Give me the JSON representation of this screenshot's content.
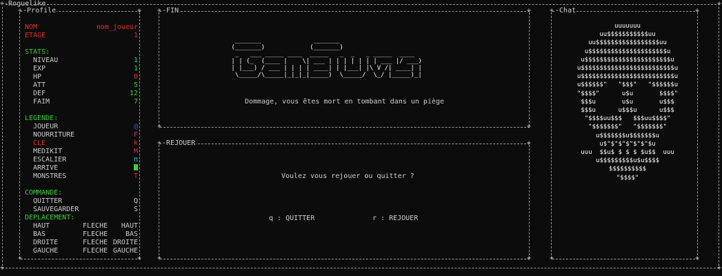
{
  "window": {
    "title": "Roguelike"
  },
  "panels": {
    "profile": "Profile",
    "fin": "FIN",
    "rejouer": "REJOUER",
    "chat": "Chat"
  },
  "profile": {
    "name_label": "NOM",
    "name_value": "nom_joueur",
    "floor_label": "ETAGE",
    "floor_value": "1",
    "stats_header": "STATS:",
    "stats": [
      {
        "label": "NIVEAU",
        "value": "1"
      },
      {
        "label": "EXP",
        "value": "1"
      },
      {
        "label": "HP",
        "value": "0"
      },
      {
        "label": "ATT",
        "value": "5"
      },
      {
        "label": "DEF",
        "value": "12"
      },
      {
        "label": "FAIM",
        "value": "7"
      }
    ],
    "legend_header": "LEGENDE:",
    "legend": [
      {
        "label": "JOUEUR",
        "symbol": "@"
      },
      {
        "label": "NOURRITURE",
        "symbol": "F"
      },
      {
        "label": "CLE",
        "symbol": "k"
      },
      {
        "label": "MEDIKIT",
        "symbol": "M"
      },
      {
        "label": "ESCALIER",
        "symbol": "π"
      },
      {
        "label": "ARRIVE",
        "symbol": ""
      },
      {
        "label": "MONSTRES",
        "symbol": "T"
      }
    ],
    "commands_header": "COMMANDE:",
    "commands": [
      {
        "label": "QUITTER",
        "key": "Q"
      },
      {
        "label": "SAUVEGARDER",
        "key": "S"
      }
    ],
    "moves_header": "DEPLACEMENT:",
    "moves": [
      {
        "label": "HAUT",
        "key": "FLECHE",
        "dir": "HAUT"
      },
      {
        "label": "BAS",
        "key": "FLECHE",
        "dir": "BAS"
      },
      {
        "label": "DROITE",
        "key": "FLECHE",
        "dir": "DROITE"
      },
      {
        "label": "GAUCHE",
        "key": "FLECHE",
        "dir": "GAUCHE"
      }
    ]
  },
  "fin": {
    "ascii_art": "  _______              _______\n (_______)            (_______)\n  _   ___ _____ ____  _____   _  _   _ _____  ____\n | | (_  (____ |    \\| ___ | | | | | | | ___ |/ ___)\n | |___) / ___ | | | | ____| | |___| |\\ V /| ____| |\n  \\_____/\\_____|_|_|_|_____)  \\_____/  \\_/ |_____)_|",
    "message": "Dommage, vous êtes mort en tombant dans un piège"
  },
  "rejouer": {
    "question": "Voulez vous rejouer ou quitter ?",
    "quit_option": "q : QUITTER",
    "replay_option": "r : REJOUER"
  },
  "chat": {
    "skull_art": "uuuuuuu\nuu$$$$$$$$$$$uu\nuu$$$$$$$$$$$$$$$$$uu\nu$$$$$$$$$$$$$$$$$$$$$u\nu$$$$$$$$$$$$$$$$$$$$$$$u\nu$$$$$$$$$$$$$$$$$$$$$$$$$u\nu$$$$$$$$$$$$$$$$$$$$$$$$$u\nu$$$$$$\"   \"$$$\"   \"$$$$$$u\n\"$$$$\"      u$u       $$$$\"\n$$$u       u$u       u$$$\n$$$u      u$$$u      u$$$\n\"$$$$uu$$$   $$$uu$$$$\"\n\"$$$$$$$\"   \"$$$$$$$\"\nu$$$$$$$u$$$$$$$u\nu$\"$\"$\"$\"$\"$\"$u\nuuu  $$u$ $ $ $ $u$$  uuu\nu$$$$$$$$$u$u$$$$\n$$$$$$$$$$\n\"$$$$\"",
    "colors": {
      "frame": "#9a9a9a",
      "bg": "#0c0c0c",
      "label_red": "#e03030",
      "label_green": "#3ad13a"
    }
  }
}
